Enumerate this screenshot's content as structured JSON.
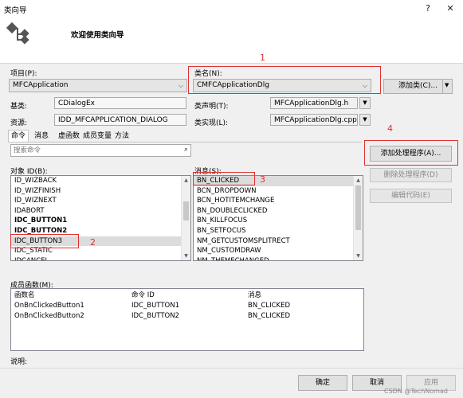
{
  "window": {
    "title": "类向导",
    "help_label": "?",
    "close_label": "✕"
  },
  "header": {
    "welcome": "欢迎使用类向导"
  },
  "project": {
    "label": "项目(P):",
    "value": "MFCApplication"
  },
  "classname": {
    "label": "类名(N):",
    "value": "CMFCApplicationDlg"
  },
  "add_class_button": "添加类(C)...",
  "base_class": {
    "label": "基类:",
    "value": "CDialogEx"
  },
  "class_decl": {
    "label": "类声明(T):",
    "value": "MFCApplicationDlg.h"
  },
  "resource": {
    "label": "资源:",
    "value": "IDD_MFCAPPLICATION_DIALOG"
  },
  "class_impl": {
    "label": "类实现(L):",
    "value": "MFCApplicationDlg.cpp"
  },
  "tabs": [
    "命令",
    "消息",
    "虚函数",
    "成员变量",
    "方法"
  ],
  "search": {
    "placeholder": "搜索命令"
  },
  "object_ids": {
    "label": "对象 ID(B):",
    "items": [
      {
        "text": "ID_WIZBACK",
        "bold": false
      },
      {
        "text": "ID_WIZFINISH",
        "bold": false
      },
      {
        "text": "ID_WIZNEXT",
        "bold": false
      },
      {
        "text": "IDABORT",
        "bold": false
      },
      {
        "text": "IDC_BUTTON1",
        "bold": true
      },
      {
        "text": "IDC_BUTTON2",
        "bold": true
      },
      {
        "text": "IDC_BUTTON3",
        "bold": false
      },
      {
        "text": "IDC_STATIC",
        "bold": false
      },
      {
        "text": "IDCANCEL",
        "bold": false
      }
    ],
    "selected_index": 6
  },
  "messages": {
    "label": "消息(S):",
    "items": [
      "BN_CLICKED",
      "BCN_DROPDOWN",
      "BCN_HOTITEMCHANGE",
      "BN_DOUBLECLICKED",
      "BN_KILLFOCUS",
      "BN_SETFOCUS",
      "NM_GETCUSTOMSPLITRECT",
      "NM_CUSTOMDRAW",
      "NM_THEMECHANGED"
    ],
    "selected_index": 0
  },
  "handler_buttons": {
    "add": "添加处理程序(A)...",
    "delete": "删除处理程序(D)",
    "edit": "编辑代码(E)"
  },
  "members": {
    "label": "成员函数(M):",
    "columns": [
      "函数名",
      "命令 ID",
      "消息"
    ],
    "rows": [
      [
        "OnBnClickedButton1",
        "IDC_BUTTON1",
        "BN_CLICKED"
      ],
      [
        "OnBnClickedButton2",
        "IDC_BUTTON2",
        "BN_CLICKED"
      ]
    ]
  },
  "description": {
    "label": "说明:"
  },
  "footer": {
    "ok": "确定",
    "cancel": "取消",
    "apply": "应用",
    "watermark": "CSDN @TechNomad"
  },
  "annotations": [
    "1",
    "2",
    "3",
    "4"
  ],
  "colors": {
    "annotation": "#e03030",
    "dialog_bg": "#f0f0f0"
  }
}
